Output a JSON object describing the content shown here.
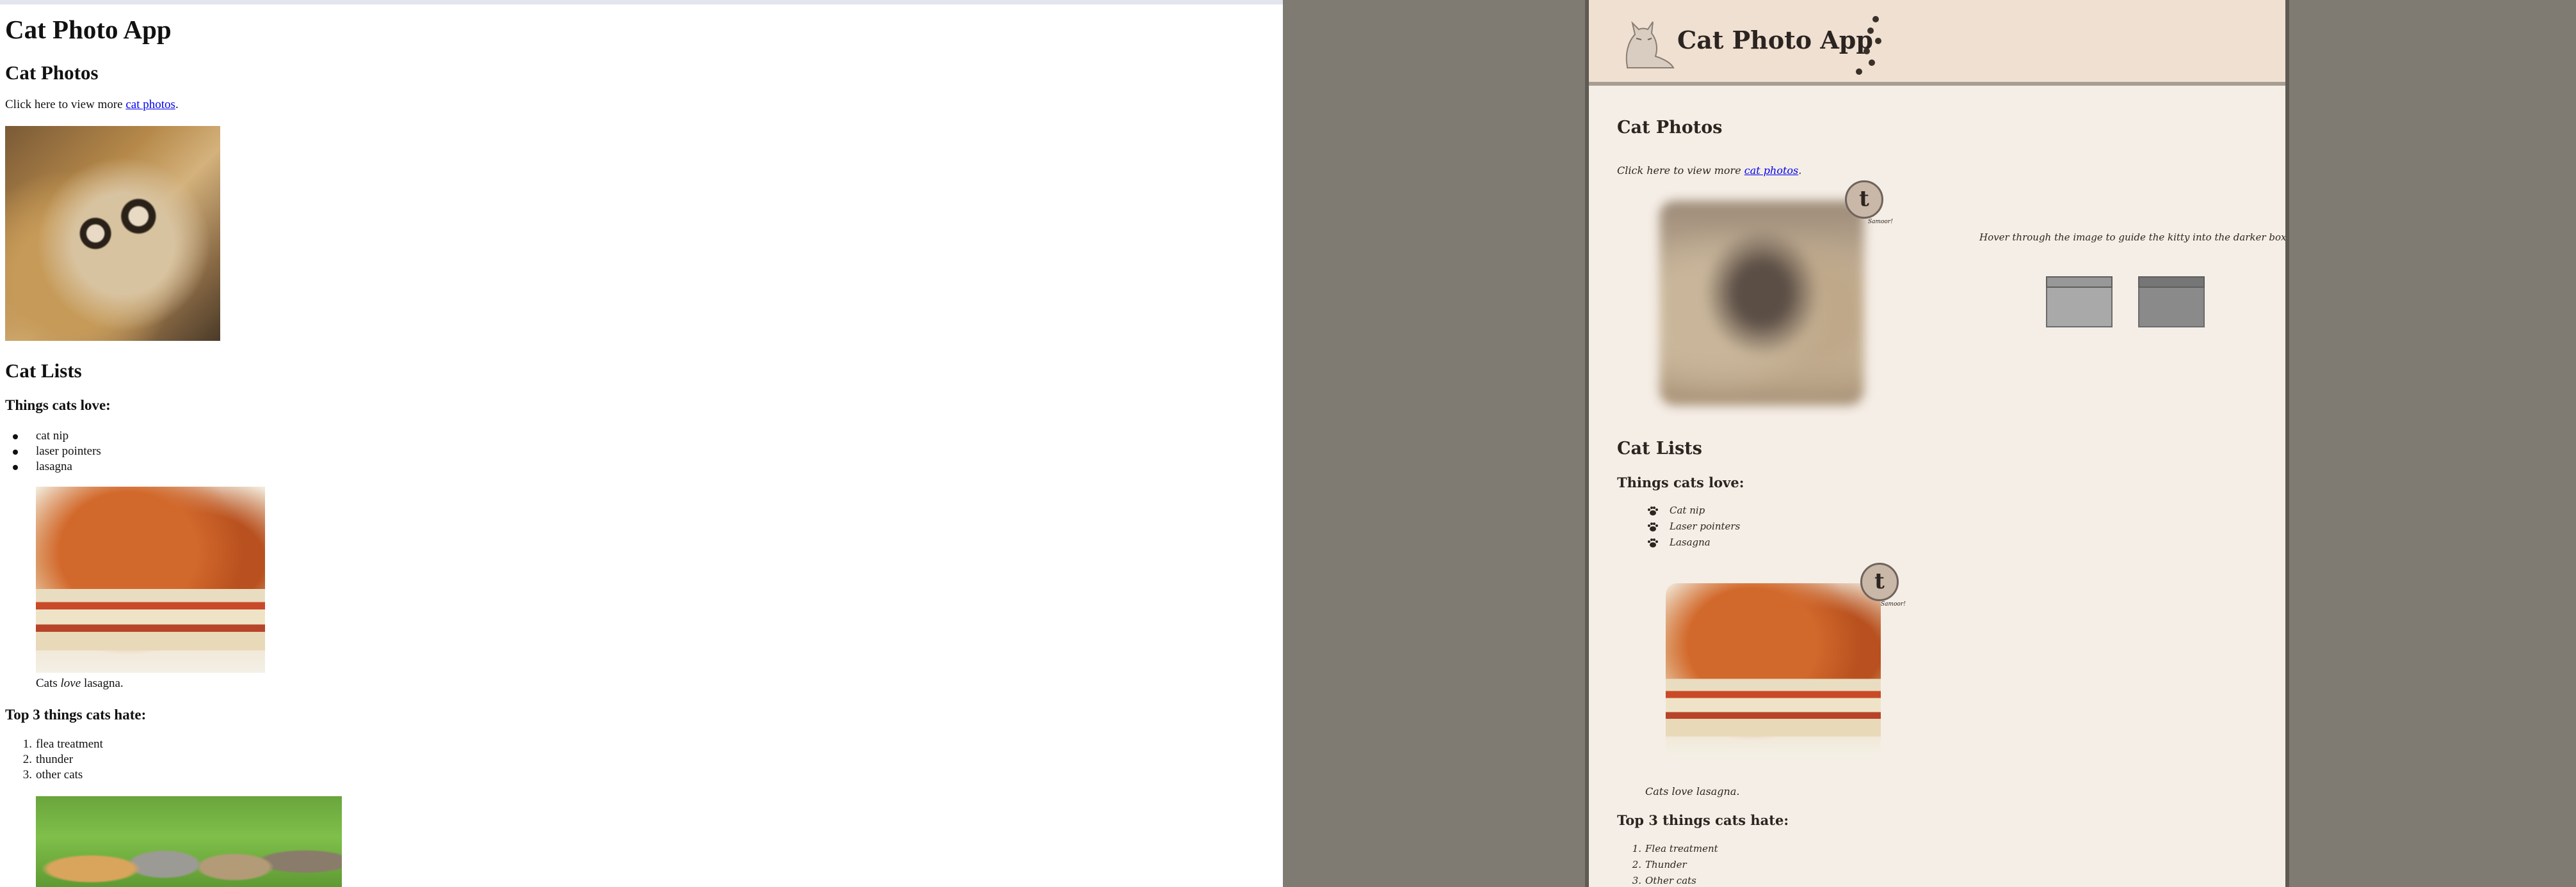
{
  "left_page": {
    "title": "Cat Photo App",
    "photos_heading": "Cat Photos",
    "photos_prefix": "Click here to view more ",
    "photos_link": "cat photos",
    "photos_suffix": ".",
    "lists_heading": "Cat Lists",
    "loves_heading": "Things cats love:",
    "loves": [
      "cat nip",
      "laser pointers",
      "lasagna"
    ],
    "caption_pre": "Cats ",
    "caption_em": "love",
    "caption_post": " lasagna.",
    "hates_heading": "Top 3 things cats hate:",
    "hates": [
      "flea treatment",
      "thunder",
      "other cats"
    ],
    "hate_numbers": [
      "1.",
      "2.",
      "3."
    ]
  },
  "right_page": {
    "title": "Cat Photo App",
    "photos_heading": "Cat Photos",
    "photos_prefix": "Click here to view more ",
    "photos_link": "cat photos",
    "photos_suffix": ".",
    "hint": "Hover through the image to guide the kitty into the darker box.",
    "badge_letter": "t",
    "badge_caption": "Samoor!",
    "lists_heading": "Cat Lists",
    "loves_heading": "Things cats love:",
    "loves": [
      "Cat nip",
      "Laser pointers",
      "Lasagna"
    ],
    "caption_pre": "Cats ",
    "caption_em": "love",
    "caption_post": " lasagna.",
    "hates_heading": "Top 3 things cats hate:",
    "hates": [
      "Flea treatment",
      "Thunder",
      "Other cats"
    ],
    "hate_numbers": [
      "1.",
      "2.",
      "3."
    ]
  },
  "icons": [
    "cat-logo-icon",
    "paw-prints-icon",
    "paw-bullet-icon"
  ],
  "colors": {
    "backdrop": "#7f7a72",
    "card_bg": "#f5eee6",
    "header_bg": "#efe0d1",
    "link": "#0000ee"
  }
}
